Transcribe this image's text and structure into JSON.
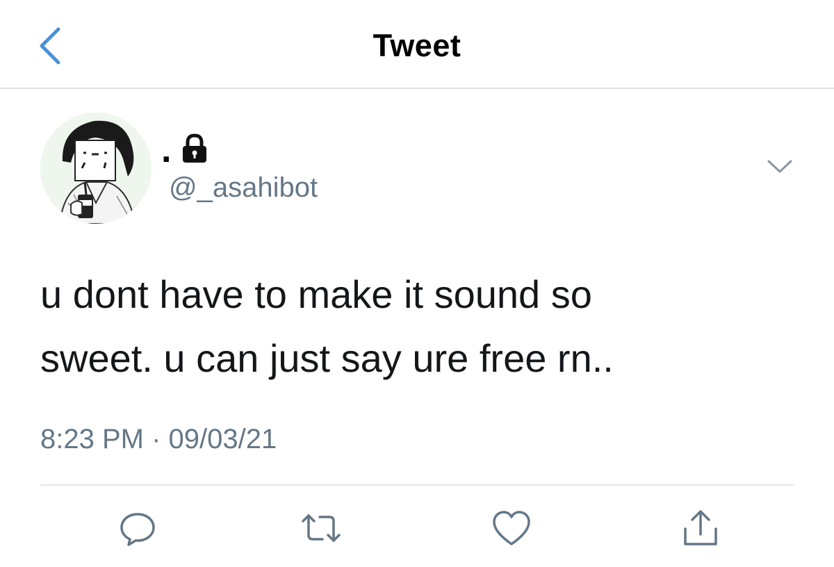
{
  "header": {
    "title": "Tweet",
    "back_icon": "chevron-left-icon",
    "accent_color": "#4a90d9"
  },
  "author": {
    "display_name": ".",
    "protected_icon": "lock-icon",
    "handle": "@_asahibot",
    "avatar": "avatar-image"
  },
  "tweet": {
    "text": "u dont have to make it sound so\nsweet. u can just say ure free rn..",
    "timestamp": "8:23 PM · 09/03/21",
    "menu_icon": "chevron-down-icon"
  },
  "actions": [
    {
      "name": "reply",
      "icon": "reply-icon"
    },
    {
      "name": "retweet",
      "icon": "retweet-icon"
    },
    {
      "name": "like",
      "icon": "heart-icon"
    },
    {
      "name": "share",
      "icon": "share-icon"
    }
  ],
  "colors": {
    "text_primary": "#14171a",
    "text_secondary": "#657786",
    "icon_gray": "#657786",
    "divider": "#e3e6e9"
  }
}
